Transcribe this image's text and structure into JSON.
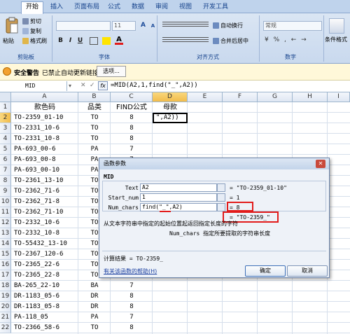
{
  "ribbon": {
    "tabs": [
      "开始",
      "插入",
      "页面布局",
      "公式",
      "数据",
      "审阅",
      "视图",
      "开发工具"
    ],
    "clipboard": {
      "paste": "粘贴",
      "cut": "剪切",
      "copy": "复制",
      "format_painter": "格式刷",
      "group": "剪贴板"
    },
    "font": {
      "size": "11",
      "group": "字体",
      "bold": "B",
      "italic": "I",
      "underline": "U"
    },
    "align": {
      "wrap": "自动换行",
      "merge": "合并后居中",
      "group": "对齐方式"
    },
    "number": {
      "format": "常规",
      "group": "数字"
    },
    "styles": {
      "cond": "条件格式"
    }
  },
  "security": {
    "title": "安全警告",
    "message": "已禁止自动更新链接",
    "options": "选项..."
  },
  "formula_bar": {
    "name_box": "MID",
    "formula": "=MID(A2,1,find(\"_\",A2))",
    "cancel": "✕",
    "enter": "✓",
    "fx": "fx"
  },
  "columns": [
    "A",
    "B",
    "C",
    "D",
    "E",
    "F",
    "G",
    "H",
    "I"
  ],
  "rows": [
    {
      "n": "1",
      "a": "款色码",
      "b": "品类",
      "c": "FIND公式",
      "d": "母款"
    },
    {
      "n": "2",
      "a": "TO-2359_01-10",
      "b": "TO",
      "c": "8",
      "d": "\",A2))"
    },
    {
      "n": "3",
      "a": "TO-2331_10-6",
      "b": "TO",
      "c": "8",
      "d": ""
    },
    {
      "n": "4",
      "a": "TO-2331_10-8",
      "b": "TO",
      "c": "8",
      "d": ""
    },
    {
      "n": "5",
      "a": "PA-693_00-6",
      "b": "PA",
      "c": "7",
      "d": ""
    },
    {
      "n": "6",
      "a": "PA-693_00-8",
      "b": "PA",
      "c": "7",
      "d": ""
    },
    {
      "n": "7",
      "a": "PA-693_00-10",
      "b": "PA",
      "c": "7",
      "d": ""
    },
    {
      "n": "8",
      "a": "TO-2361_13-10",
      "b": "TO",
      "c": "8",
      "d": ""
    },
    {
      "n": "9",
      "a": "TO-2362_71-6",
      "b": "TO",
      "c": "8",
      "d": ""
    },
    {
      "n": "10",
      "a": "TO-2362_71-8",
      "b": "TO",
      "c": "8",
      "d": ""
    },
    {
      "n": "11",
      "a": "TO-2362_71-10",
      "b": "TO",
      "c": "8",
      "d": ""
    },
    {
      "n": "12",
      "a": "TO-2332_10-6",
      "b": "TO",
      "c": "8",
      "d": ""
    },
    {
      "n": "13",
      "a": "TO-2332_10-8",
      "b": "TO",
      "c": "8",
      "d": ""
    },
    {
      "n": "14",
      "a": "TO-55432_13-10",
      "b": "TO",
      "c": "9",
      "d": ""
    },
    {
      "n": "15",
      "a": "TO-2367_120-6",
      "b": "TO",
      "c": "8",
      "d": ""
    },
    {
      "n": "16",
      "a": "TO-2365_22-6",
      "b": "TO",
      "c": "8",
      "d": ""
    },
    {
      "n": "17",
      "a": "TO-2365_22-8",
      "b": "TO",
      "c": "8",
      "d": ""
    },
    {
      "n": "18",
      "a": "BA-265_22-10",
      "b": "BA",
      "c": "7",
      "d": ""
    },
    {
      "n": "19",
      "a": "DR-1183_05-6",
      "b": "DR",
      "c": "8",
      "d": ""
    },
    {
      "n": "20",
      "a": "DR-1183_05-8",
      "b": "DR",
      "c": "8",
      "d": ""
    },
    {
      "n": "21",
      "a": "PA-118_05",
      "b": "PA",
      "c": "7",
      "d": ""
    },
    {
      "n": "22",
      "a": "TO-2366_58-6",
      "b": "TO",
      "c": "8",
      "d": ""
    }
  ],
  "dialog": {
    "title": "函数参数",
    "func_name": "MID",
    "args": [
      {
        "label": "Text",
        "value": "A2",
        "result": "= \"TO-2359_01-10\""
      },
      {
        "label": "Start_num",
        "value": "1",
        "result": "= 1"
      },
      {
        "label": "Num_chars",
        "value": "find(\"_\",A2)",
        "result": "= 8"
      }
    ],
    "overall_result": "= \"TO-2359_\"",
    "description": "从文本字符串中指定的起始位置起返回指定长度的字符",
    "arg_description": "Num_chars  指定所要提取的字符串长度",
    "calc_result": "计算结果 = TO-2359_",
    "help_link": "有关该函数的帮助(H)",
    "ok": "确定",
    "cancel": "取消"
  }
}
